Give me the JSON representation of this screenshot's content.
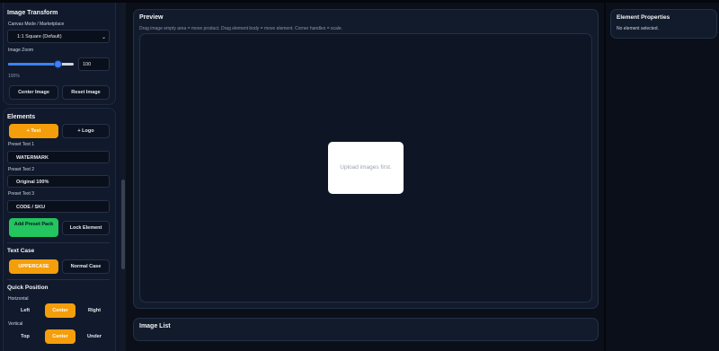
{
  "transform": {
    "title": "Image Transform",
    "canvas_mode_label": "Canvas Mode / Marketplace",
    "canvas_mode_value": "1:1 Square (Default)",
    "zoom_label": "Image Zoom",
    "zoom_value": "100",
    "zoom_percent_text": "100%",
    "zoom_fraction": 0.75,
    "center_image_label": "Center Image",
    "reset_image_label": "Reset Image"
  },
  "elements": {
    "title": "Elements",
    "add_text_label": "+ Text",
    "add_logo_label": "+ Logo",
    "preset1_label": "Preset Text 1",
    "preset1_value": "WATERMARK",
    "preset2_label": "Preset Text 2",
    "preset2_value": "Original 100%",
    "preset3_label": "Preset Text 3",
    "preset3_value": "CODE / SKU",
    "add_preset_pack_label": "Add Preset Pack",
    "lock_element_label": "Lock Element",
    "text_case_title": "Text Case",
    "uppercase_label": "UPPERCASE",
    "normal_case_label": "Normal Case",
    "quick_position_title": "Quick Position",
    "horizontal_label": "Horizontal",
    "left_label": "Left",
    "center_h_label": "Center",
    "right_label": "Right",
    "vertical_label": "Vertical",
    "top_label": "Top",
    "center_v_label": "Center",
    "under_label": "Under"
  },
  "preview": {
    "title": "Preview",
    "hint": "Drag image empty area = move product. Drag element body = move element. Corner handles = scale.",
    "placeholder": "Upload images first."
  },
  "image_list": {
    "title": "Image List"
  },
  "properties": {
    "title": "Element Properties",
    "empty_text": "No element selected."
  },
  "colors": {
    "accent_orange": "#f59e0b",
    "accent_green": "#22c55e",
    "accent_blue": "#3b82f6"
  }
}
